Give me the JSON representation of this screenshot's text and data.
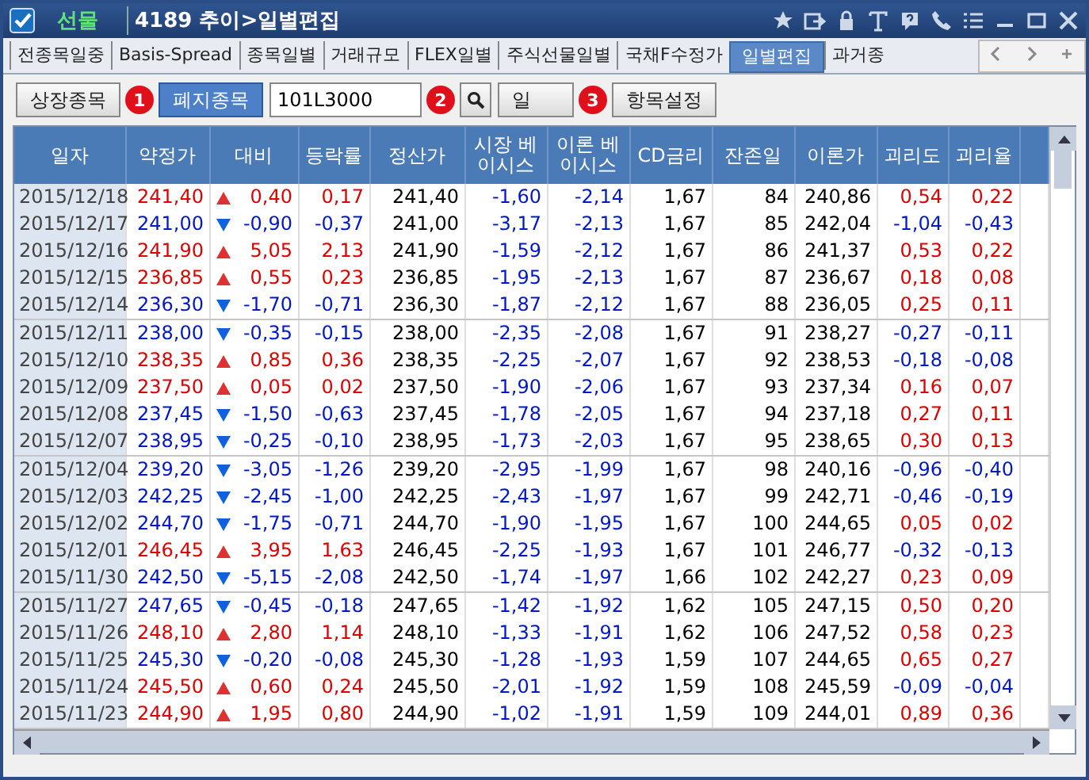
{
  "window": {
    "category": "선물",
    "title": "4189 추이>일별편집"
  },
  "tabs": [
    {
      "label": "전종목일중",
      "selected": false
    },
    {
      "label": "Basis-Spread",
      "selected": false
    },
    {
      "label": "종목일별",
      "selected": false
    },
    {
      "label": "거래규모",
      "selected": false
    },
    {
      "label": "FLEX일별",
      "selected": false
    },
    {
      "label": "주식선물일별",
      "selected": false
    },
    {
      "label": "국채F수정가",
      "selected": false
    },
    {
      "label": "일별편집",
      "selected": true
    },
    {
      "label": "과거종",
      "selected": false
    }
  ],
  "toolbar": {
    "segments": [
      {
        "label": "상장종목",
        "selected": false
      },
      {
        "label": "폐지종목",
        "selected": true
      }
    ],
    "code_field": {
      "value": "101L3000"
    },
    "period_select": {
      "value": "일"
    },
    "settings_button": "항목설정",
    "badges": [
      "1",
      "2",
      "3"
    ]
  },
  "table": {
    "columns": [
      "일자",
      "약정가",
      "대비",
      "등락률",
      "정산가",
      "시장 베이시스",
      "이론 베이시스",
      "CD금리",
      "잔존일",
      "이론가",
      "괴리도",
      "괴리율"
    ],
    "rows": [
      {
        "date": "2015/12/18",
        "price": "241,40",
        "rising": true,
        "change": "0,40",
        "rate": "0,17",
        "settle": "241,40",
        "market_basis": "-1,60",
        "theory_basis": "-2,14",
        "cd_rate": "1,67",
        "days_left": "84",
        "theory_price": "240,86",
        "gap_positive": true,
        "gap": "0,54",
        "gap_rate": "0,22"
      },
      {
        "date": "2015/12/17",
        "price": "241,00",
        "rising": false,
        "change": "-0,90",
        "rate": "-0,37",
        "settle": "241,00",
        "market_basis": "-3,17",
        "theory_basis": "-2,13",
        "cd_rate": "1,67",
        "days_left": "85",
        "theory_price": "242,04",
        "gap_positive": false,
        "gap": "-1,04",
        "gap_rate": "-0,43"
      },
      {
        "date": "2015/12/16",
        "price": "241,90",
        "rising": true,
        "change": "5,05",
        "rate": "2,13",
        "settle": "241,90",
        "market_basis": "-1,59",
        "theory_basis": "-2,12",
        "cd_rate": "1,67",
        "days_left": "86",
        "theory_price": "241,37",
        "gap_positive": true,
        "gap": "0,53",
        "gap_rate": "0,22"
      },
      {
        "date": "2015/12/15",
        "price": "236,85",
        "rising": true,
        "change": "0,55",
        "rate": "0,23",
        "settle": "236,85",
        "market_basis": "-1,95",
        "theory_basis": "-2,13",
        "cd_rate": "1,67",
        "days_left": "87",
        "theory_price": "236,67",
        "gap_positive": true,
        "gap": "0,18",
        "gap_rate": "0,08"
      },
      {
        "date": "2015/12/14",
        "price": "236,30",
        "rising": false,
        "change": "-1,70",
        "rate": "-0,71",
        "settle": "236,30",
        "market_basis": "-1,87",
        "theory_basis": "-2,12",
        "cd_rate": "1,67",
        "days_left": "88",
        "theory_price": "236,05",
        "gap_positive": true,
        "gap": "0,25",
        "gap_rate": "0,11"
      },
      {
        "date": "2015/12/11",
        "price": "238,00",
        "rising": false,
        "change": "-0,35",
        "rate": "-0,15",
        "settle": "238,00",
        "market_basis": "-2,35",
        "theory_basis": "-2,08",
        "cd_rate": "1,67",
        "days_left": "91",
        "theory_price": "238,27",
        "gap_positive": false,
        "gap": "-0,27",
        "gap_rate": "-0,11"
      },
      {
        "date": "2015/12/10",
        "price": "238,35",
        "rising": true,
        "change": "0,85",
        "rate": "0,36",
        "settle": "238,35",
        "market_basis": "-2,25",
        "theory_basis": "-2,07",
        "cd_rate": "1,67",
        "days_left": "92",
        "theory_price": "238,53",
        "gap_positive": false,
        "gap": "-0,18",
        "gap_rate": "-0,08"
      },
      {
        "date": "2015/12/09",
        "price": "237,50",
        "rising": true,
        "change": "0,05",
        "rate": "0,02",
        "settle": "237,50",
        "market_basis": "-1,90",
        "theory_basis": "-2,06",
        "cd_rate": "1,67",
        "days_left": "93",
        "theory_price": "237,34",
        "gap_positive": true,
        "gap": "0,16",
        "gap_rate": "0,07"
      },
      {
        "date": "2015/12/08",
        "price": "237,45",
        "rising": false,
        "change": "-1,50",
        "rate": "-0,63",
        "settle": "237,45",
        "market_basis": "-1,78",
        "theory_basis": "-2,05",
        "cd_rate": "1,67",
        "days_left": "94",
        "theory_price": "237,18",
        "gap_positive": true,
        "gap": "0,27",
        "gap_rate": "0,11"
      },
      {
        "date": "2015/12/07",
        "price": "238,95",
        "rising": false,
        "change": "-0,25",
        "rate": "-0,10",
        "settle": "238,95",
        "market_basis": "-1,73",
        "theory_basis": "-2,03",
        "cd_rate": "1,67",
        "days_left": "95",
        "theory_price": "238,65",
        "gap_positive": true,
        "gap": "0,30",
        "gap_rate": "0,13"
      },
      {
        "date": "2015/12/04",
        "price": "239,20",
        "rising": false,
        "change": "-3,05",
        "rate": "-1,26",
        "settle": "239,20",
        "market_basis": "-2,95",
        "theory_basis": "-1,99",
        "cd_rate": "1,67",
        "days_left": "98",
        "theory_price": "240,16",
        "gap_positive": false,
        "gap": "-0,96",
        "gap_rate": "-0,40"
      },
      {
        "date": "2015/12/03",
        "price": "242,25",
        "rising": false,
        "change": "-2,45",
        "rate": "-1,00",
        "settle": "242,25",
        "market_basis": "-2,43",
        "theory_basis": "-1,97",
        "cd_rate": "1,67",
        "days_left": "99",
        "theory_price": "242,71",
        "gap_positive": false,
        "gap": "-0,46",
        "gap_rate": "-0,19"
      },
      {
        "date": "2015/12/02",
        "price": "244,70",
        "rising": false,
        "change": "-1,75",
        "rate": "-0,71",
        "settle": "244,70",
        "market_basis": "-1,90",
        "theory_basis": "-1,95",
        "cd_rate": "1,67",
        "days_left": "100",
        "theory_price": "244,65",
        "gap_positive": true,
        "gap": "0,05",
        "gap_rate": "0,02"
      },
      {
        "date": "2015/12/01",
        "price": "246,45",
        "rising": true,
        "change": "3,95",
        "rate": "1,63",
        "settle": "246,45",
        "market_basis": "-2,25",
        "theory_basis": "-1,93",
        "cd_rate": "1,67",
        "days_left": "101",
        "theory_price": "246,77",
        "gap_positive": false,
        "gap": "-0,32",
        "gap_rate": "-0,13"
      },
      {
        "date": "2015/11/30",
        "price": "242,50",
        "rising": false,
        "change": "-5,15",
        "rate": "-2,08",
        "settle": "242,50",
        "market_basis": "-1,74",
        "theory_basis": "-1,97",
        "cd_rate": "1,66",
        "days_left": "102",
        "theory_price": "242,27",
        "gap_positive": true,
        "gap": "0,23",
        "gap_rate": "0,09"
      },
      {
        "date": "2015/11/27",
        "price": "247,65",
        "rising": false,
        "change": "-0,45",
        "rate": "-0,18",
        "settle": "247,65",
        "market_basis": "-1,42",
        "theory_basis": "-1,92",
        "cd_rate": "1,62",
        "days_left": "105",
        "theory_price": "247,15",
        "gap_positive": true,
        "gap": "0,50",
        "gap_rate": "0,20"
      },
      {
        "date": "2015/11/26",
        "price": "248,10",
        "rising": true,
        "change": "2,80",
        "rate": "1,14",
        "settle": "248,10",
        "market_basis": "-1,33",
        "theory_basis": "-1,91",
        "cd_rate": "1,62",
        "days_left": "106",
        "theory_price": "247,52",
        "gap_positive": true,
        "gap": "0,58",
        "gap_rate": "0,23"
      },
      {
        "date": "2015/11/25",
        "price": "245,30",
        "rising": false,
        "change": "-0,20",
        "rate": "-0,08",
        "settle": "245,30",
        "market_basis": "-1,28",
        "theory_basis": "-1,93",
        "cd_rate": "1,59",
        "days_left": "107",
        "theory_price": "244,65",
        "gap_positive": true,
        "gap": "0,65",
        "gap_rate": "0,27"
      },
      {
        "date": "2015/11/24",
        "price": "245,50",
        "rising": true,
        "change": "0,60",
        "rate": "0,24",
        "settle": "245,50",
        "market_basis": "-2,01",
        "theory_basis": "-1,92",
        "cd_rate": "1,59",
        "days_left": "108",
        "theory_price": "245,59",
        "gap_positive": false,
        "gap": "-0,09",
        "gap_rate": "-0,04"
      },
      {
        "date": "2015/11/23",
        "price": "244,90",
        "rising": true,
        "change": "1,95",
        "rate": "0,80",
        "settle": "244,90",
        "market_basis": "-1,02",
        "theory_basis": "-1,91",
        "cd_rate": "1,59",
        "days_left": "109",
        "theory_price": "244,01",
        "gap_positive": true,
        "gap": "0,89",
        "gap_rate": "0,36"
      }
    ]
  }
}
